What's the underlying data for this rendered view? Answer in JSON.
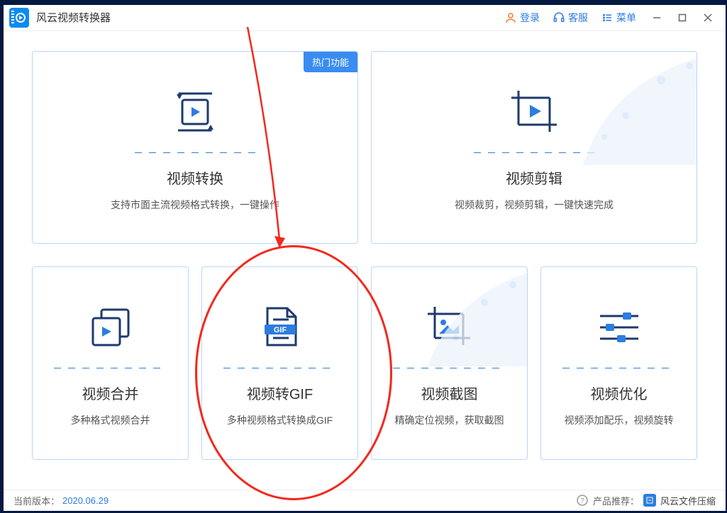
{
  "app": {
    "title": "风云视频转换器"
  },
  "titlebar": {
    "login": "登录",
    "support": "客服",
    "menu": "菜单"
  },
  "badge_hot": "热门功能",
  "cards": {
    "convert": {
      "title": "视频转换",
      "desc": "支持市面主流视频格式转换，一键操作"
    },
    "edit": {
      "title": "视频剪辑",
      "desc": "视频裁剪，视频剪辑，一键快速完成"
    },
    "merge": {
      "title": "视频合并",
      "desc": "多种格式视频合并"
    },
    "gif": {
      "title": "视频转GIF",
      "desc": "多种视频格式转换成GIF"
    },
    "screenshot": {
      "title": "视频截图",
      "desc": "精确定位视频，获取截图"
    },
    "optimize": {
      "title": "视频优化",
      "desc": "视频添加配乐，视频旋转"
    }
  },
  "gif_label": "GIF",
  "footer": {
    "version_label": "当前版本：",
    "version_value": "2020.06.29",
    "recommend_label": "产品推荐：",
    "recommend_product": "风云文件压缩"
  }
}
